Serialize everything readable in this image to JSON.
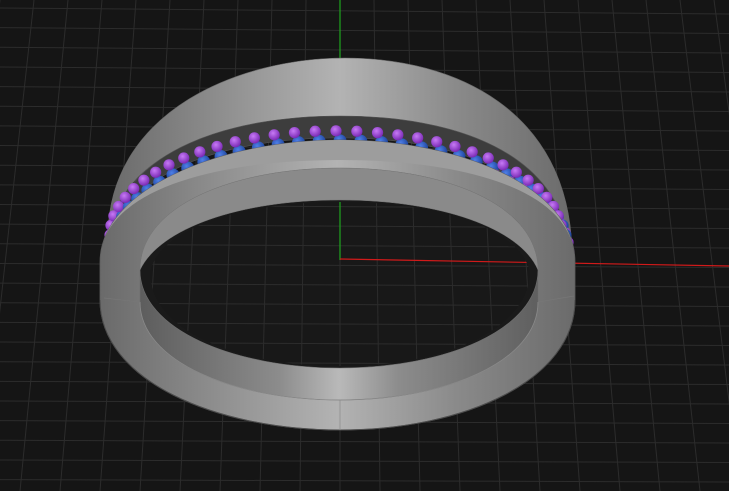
{
  "viewport": {
    "background_color": "#151515",
    "grid_color": "#2c2c2c",
    "axis_x_color": "#d21a1a",
    "axis_y_color": "#1ea51e"
  },
  "model": {
    "metal_color": "#8e8e8e",
    "metal_dark": "#5a5a5a",
    "metal_light": "#c4c4c4",
    "stone_inner_color": "#1f4fb0",
    "stone_outer_color": "#8a2fc9",
    "stone_highlight": "#c07af0"
  }
}
